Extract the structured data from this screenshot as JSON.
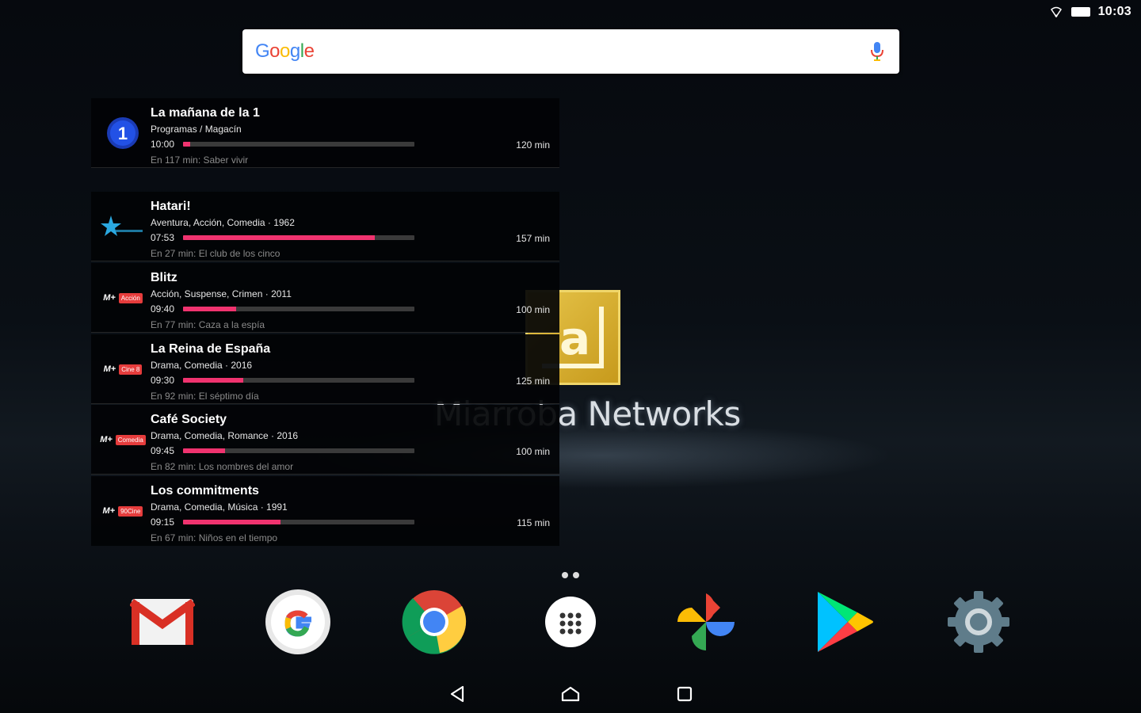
{
  "status_bar": {
    "time": "10:03"
  },
  "search": {
    "logo_text": "Google"
  },
  "tv_widget": {
    "items": [
      {
        "channel": "La 1",
        "title": "La mañana de la 1",
        "genre": "Programas / Magacín",
        "start": "10:00",
        "progress": 0.03,
        "next": "En 117 min: Saber vivir",
        "duration": "120 min"
      },
      {
        "channel": "Estrellas",
        "title": "Hatari!",
        "genre": "Aventura, Acción, Comedia · 1962",
        "start": "07:53",
        "progress": 0.83,
        "next": "En 27 min: El club de los cinco",
        "duration": "157 min"
      },
      {
        "channel": "M+ Acción",
        "channel_tag": "Acción",
        "title": "Blitz",
        "genre": "Acción, Suspense, Crimen · 2011",
        "start": "09:40",
        "progress": 0.23,
        "next": "En 77 min: Caza a la espía",
        "duration": "100 min"
      },
      {
        "channel": "M+ Cine",
        "channel_tag": "Cine 8",
        "title": "La Reina de España",
        "genre": "Drama, Comedia · 2016",
        "start": "09:30",
        "progress": 0.26,
        "next": "En 92 min: El séptimo día",
        "duration": "125 min"
      },
      {
        "channel": "M+ Comedia",
        "channel_tag": "Comedia",
        "title": "Café Society",
        "genre": "Drama, Comedia, Romance · 2016",
        "start": "09:45",
        "progress": 0.18,
        "next": "En 82 min: Los nombres del amor",
        "duration": "100 min"
      },
      {
        "channel": "M+ 90Cine",
        "channel_tag": "90Cine",
        "title": "Los commitments",
        "genre": "Drama, Comedia, Música · 1991",
        "start": "09:15",
        "progress": 0.42,
        "next": "En 67 min: Niños en el tiempo",
        "duration": "115 min"
      }
    ]
  },
  "wallpaper": {
    "brand_text": "Miarroba Networks",
    "logo_glyph": "a"
  },
  "dock": {
    "apps": [
      {
        "name": "gmail-icon"
      },
      {
        "name": "google-icon"
      },
      {
        "name": "chrome-icon"
      },
      {
        "name": "app-drawer-icon"
      },
      {
        "name": "photos-icon"
      },
      {
        "name": "play-store-icon"
      },
      {
        "name": "settings-icon"
      }
    ]
  },
  "colors": {
    "accent": "#f0336f",
    "bar_track": "#3a3a3a"
  }
}
